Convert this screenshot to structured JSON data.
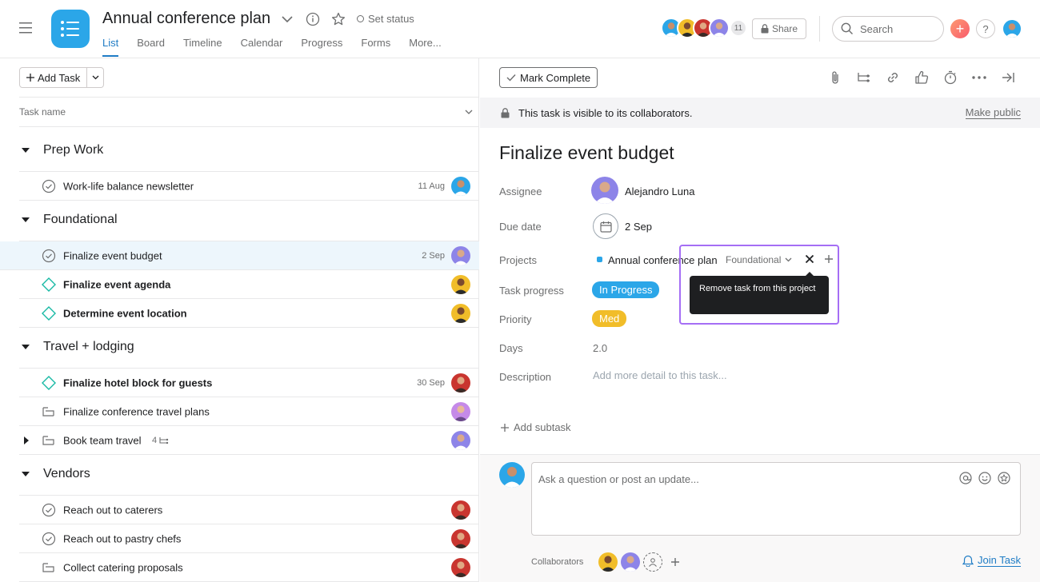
{
  "header": {
    "project_title": "Annual conference plan",
    "set_status": "Set status",
    "tabs": [
      {
        "label": "List",
        "active": true
      },
      {
        "label": "Board",
        "active": false
      },
      {
        "label": "Timeline",
        "active": false
      },
      {
        "label": "Calendar",
        "active": false
      },
      {
        "label": "Progress",
        "active": false
      },
      {
        "label": "Forms",
        "active": false
      },
      {
        "label": "More..."
      }
    ],
    "member_count": "11",
    "share_label": "Share",
    "search_placeholder": "Search",
    "help_label": "?"
  },
  "list": {
    "add_task_label": "Add Task",
    "column_header": "Task name",
    "sections": [
      {
        "title": "Prep Work"
      },
      {
        "title": "Foundational"
      },
      {
        "title": "Travel + lodging"
      },
      {
        "title": "Vendors"
      }
    ],
    "tasks": [
      {
        "name": "Work-life balance newsletter",
        "date": "11 Aug",
        "icon": "check-circle-icon"
      },
      {
        "name": "Finalize event budget",
        "date": "2 Sep",
        "icon": "check-circle-icon"
      },
      {
        "name": "Finalize event agenda",
        "date": "",
        "icon": "milestone-diamond-icon"
      },
      {
        "name": "Determine event location",
        "date": "",
        "icon": "milestone-diamond-icon"
      },
      {
        "name": "Finalize hotel block for guests",
        "date": "30 Sep",
        "icon": "milestone-diamond-icon"
      },
      {
        "name": "Finalize conference travel plans",
        "date": "",
        "icon": "approval-icon"
      },
      {
        "name": "Book team travel",
        "date": "",
        "icon": "approval-icon",
        "subtask_count": "4"
      },
      {
        "name": "Reach out to caterers",
        "date": "",
        "icon": "check-circle-icon"
      },
      {
        "name": "Reach out to pastry chefs",
        "date": "",
        "icon": "check-circle-icon"
      },
      {
        "name": "Collect catering proposals",
        "date": "",
        "icon": "approval-icon"
      }
    ]
  },
  "detail": {
    "mark_complete": "Mark Complete",
    "visibility_text": "This task is visible to its collaborators.",
    "make_public": "Make public",
    "title": "Finalize event budget",
    "fields": {
      "assignee_label": "Assignee",
      "assignee_value": "Alejandro Luna",
      "due_label": "Due date",
      "due_value": "2 Sep",
      "projects_label": "Projects",
      "project_name": "Annual conference plan",
      "project_section": "Foundational",
      "progress_label": "Task progress",
      "progress_value": "In Progress",
      "priority_label": "Priority",
      "priority_value": "Med",
      "days_label": "Days",
      "days_value": "2.0",
      "description_label": "Description",
      "description_placeholder": "Add more detail to this task..."
    },
    "tooltip": "Remove task from this project",
    "add_subtask": "Add subtask",
    "comment_placeholder": "Ask a question or post an update...",
    "collaborators_label": "Collaborators",
    "join_task": "Join Task"
  },
  "colors": {
    "accent": "#1f7cc5",
    "project_icon": "#2ba6e8",
    "in_progress": "#2ba6e8",
    "priority_med": "#f1bd29",
    "highlight": "#a56ef5"
  }
}
